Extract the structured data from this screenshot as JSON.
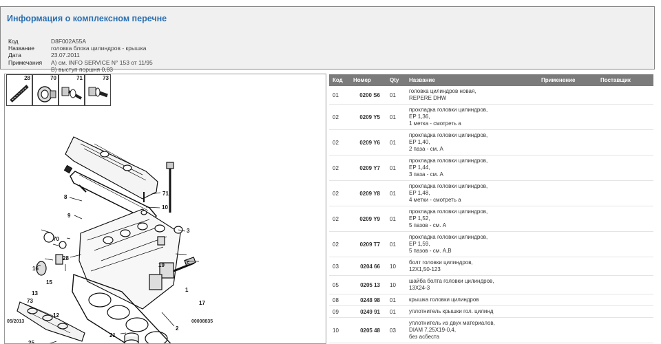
{
  "header": {
    "title": "Информация о комплексном перечне",
    "fields": [
      {
        "label": "Код",
        "value": "D8F002A55A"
      },
      {
        "label": "Название",
        "value": "головка блока цилиндров - крышка"
      },
      {
        "label": "Дата",
        "value": "23.07.2011"
      },
      {
        "label": "Примечания",
        "value": "A) см. INFO SERVICE N° 153 от 11/95"
      },
      {
        "label": "",
        "value": "B) выступ поршня 0,83"
      }
    ]
  },
  "thumbnails": [
    "28",
    "70",
    "71",
    "73"
  ],
  "diagram": {
    "labels": [
      "8",
      "71",
      "10",
      "9",
      "3",
      "70",
      "28",
      "19",
      "5",
      "16",
      "15",
      "13",
      "1",
      "17",
      "73",
      "12",
      "2",
      "21",
      "25"
    ],
    "footer_date": "05/2013",
    "footer_code": "00008835"
  },
  "table": {
    "headers": {
      "code": "Код",
      "number": "Номер",
      "qty": "Qty",
      "name": "Название",
      "usage": "Применение",
      "supplier": "Поставщик"
    },
    "rows": [
      {
        "code": "01",
        "number": "0200 S6",
        "qty": "01",
        "name": [
          "головка цилиндров новая,",
          "REPERE DHW"
        ]
      },
      {
        "code": "02",
        "number": "0209 Y5",
        "qty": "01",
        "name": [
          "прокладка головки цилиндров,",
          "EP 1,36,",
          "1 метка - смотреть a"
        ]
      },
      {
        "code": "02",
        "number": "0209 Y6",
        "qty": "01",
        "name": [
          "прокладка головки цилиндров,",
          "EP 1,40,",
          "2 паза - см. A"
        ]
      },
      {
        "code": "02",
        "number": "0209 Y7",
        "qty": "01",
        "name": [
          "прокладка головки цилиндров,",
          "EP 1,44,",
          "3 паза - см. A"
        ]
      },
      {
        "code": "02",
        "number": "0209 Y8",
        "qty": "01",
        "name": [
          "прокладка головки цилиндров,",
          "EP 1,48,",
          "4 метки - смотреть a"
        ]
      },
      {
        "code": "02",
        "number": "0209 Y9",
        "qty": "01",
        "name": [
          "прокладка головки цилиндров,",
          "EP 1,52,",
          "5 пазов - см. A"
        ]
      },
      {
        "code": "02",
        "number": "0209 T7",
        "qty": "01",
        "name": [
          "прокладка головки цилиндров,",
          "EP 1,59,",
          "5 пазов - см. A,B"
        ]
      },
      {
        "code": "03",
        "number": "0204 66",
        "qty": "10",
        "name": [
          "болт головки цилиндров,",
          "12X1,50-123"
        ]
      },
      {
        "code": "05",
        "number": "0205 13",
        "qty": "10",
        "name": [
          "шайба болта головки цилиндров,",
          "13X24-3"
        ]
      },
      {
        "code": "08",
        "number": "0248 98",
        "qty": "01",
        "name": [
          "крышка головки цилиндров"
        ]
      },
      {
        "code": "09",
        "number": "0249 91",
        "qty": "01",
        "name": [
          "уплотнитель крышки гол. цилинд"
        ]
      },
      {
        "code": "10",
        "number": "0205 48",
        "qty": "03",
        "name": [
          "уплотнитель из двух материалов,",
          "DIAM 7,25X19-0,4,",
          "без асбеста"
        ]
      }
    ]
  }
}
